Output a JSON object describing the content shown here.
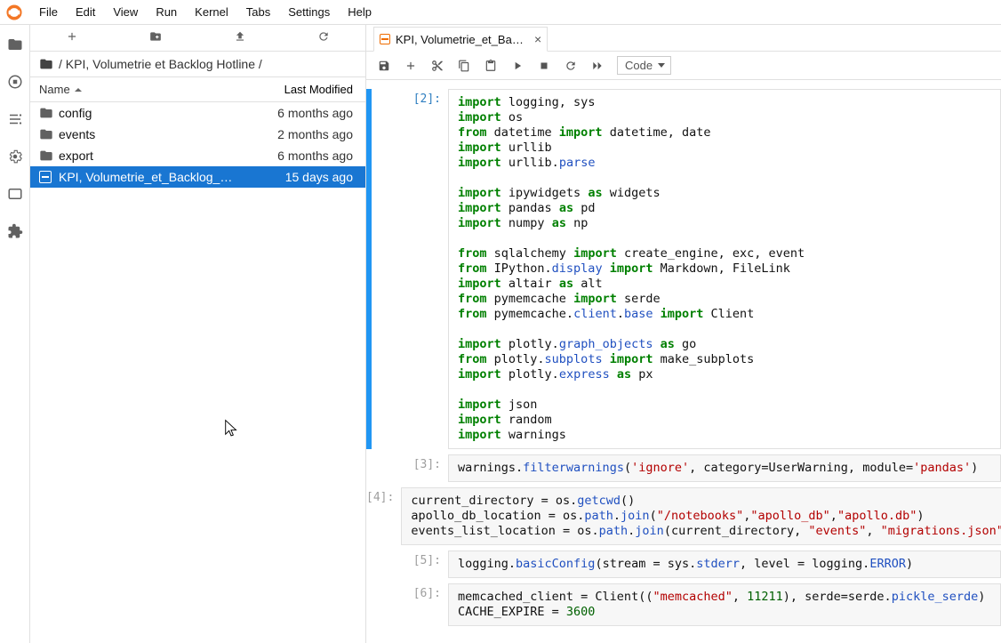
{
  "menu": {
    "items": [
      "File",
      "Edit",
      "View",
      "Run",
      "Kernel",
      "Tabs",
      "Settings",
      "Help"
    ]
  },
  "sidebar": {
    "breadcrumb_parts": [
      "/ KPI, Volumetrie et Backlog Hotline /"
    ],
    "columns": {
      "name": "Name",
      "modified": "Last Modified"
    },
    "files": [
      {
        "type": "folder",
        "name": "config",
        "modified": "6 months ago",
        "selected": false
      },
      {
        "type": "folder",
        "name": "events",
        "modified": "2 months ago",
        "selected": false
      },
      {
        "type": "folder",
        "name": "export",
        "modified": "6 months ago",
        "selected": false
      },
      {
        "type": "notebook",
        "name": "KPI, Volumetrie_et_Backlog_HOTLI…",
        "modified": "15 days ago",
        "selected": true
      }
    ]
  },
  "tab": {
    "label": "KPI, Volumetrie_et_Backlog_H"
  },
  "toolbar": {
    "celltype": "Code"
  },
  "cells": [
    {
      "prompt": "[2]:",
      "active": true,
      "code_html": "<span class='kw'>import</span> logging, sys\n<span class='kw'>import</span> os\n<span class='kw'>from</span> datetime <span class='kw'>import</span> datetime, date\n<span class='kw'>import</span> urllib\n<span class='kw'>import</span> urllib.<span class='attr'>parse</span>\n\n<span class='kw'>import</span> ipywidgets <span class='kw'>as</span> widgets\n<span class='kw'>import</span> pandas <span class='kw'>as</span> pd\n<span class='kw'>import</span> numpy <span class='kw'>as</span> np\n\n<span class='kw'>from</span> sqlalchemy <span class='kw'>import</span> create_engine, exc, event\n<span class='kw'>from</span> IPython.<span class='attr'>display</span> <span class='kw'>import</span> Markdown, FileLink\n<span class='kw'>import</span> altair <span class='kw'>as</span> alt\n<span class='kw'>from</span> pymemcache <span class='kw'>import</span> serde\n<span class='kw'>from</span> pymemcache.<span class='attr'>client</span>.<span class='attr'>base</span> <span class='kw'>import</span> Client\n\n<span class='kw'>import</span> plotly.<span class='attr'>graph_objects</span> <span class='kw'>as</span> go\n<span class='kw'>from</span> plotly.<span class='attr'>subplots</span> <span class='kw'>import</span> make_subplots\n<span class='kw'>import</span> plotly.<span class='attr'>express</span> <span class='kw'>as</span> px\n\n<span class='kw'>import</span> json\n<span class='kw'>import</span> random\n<span class='kw'>import</span> warnings"
    },
    {
      "prompt": "[3]:",
      "active": false,
      "code_html": "warnings.<span class='attr'>filterwarnings</span>(<span class='str'>'ignore'</span>, category=UserWarning, module=<span class='str'>'pandas'</span>)"
    },
    {
      "prompt": "[4]:",
      "active": false,
      "code_html": "current_directory = os.<span class='attr'>getcwd</span>()\napollo_db_location = os.<span class='attr'>path</span>.<span class='attr'>join</span>(<span class='str'>\"/notebooks\"</span>,<span class='str'>\"apollo_db\"</span>,<span class='str'>\"apollo.db\"</span>)\nevents_list_location = os.<span class='attr'>path</span>.<span class='attr'>join</span>(current_directory, <span class='str'>\"events\"</span>, <span class='str'>\"migrations.json\"</span>)"
    },
    {
      "prompt": "[5]:",
      "active": false,
      "code_html": "logging.<span class='attr'>basicConfig</span>(stream = sys.<span class='attr'>stderr</span>, level = logging.<span class='attr'>ERROR</span>)"
    },
    {
      "prompt": "[6]:",
      "active": false,
      "code_html": "memcached_client = Client((<span class='str'>\"memcached\"</span>, <span class='num'>11211</span>), serde=serde.<span class='attr'>pickle_serde</span>)\nCACHE_EXPIRE = <span class='num'>3600</span>"
    }
  ]
}
